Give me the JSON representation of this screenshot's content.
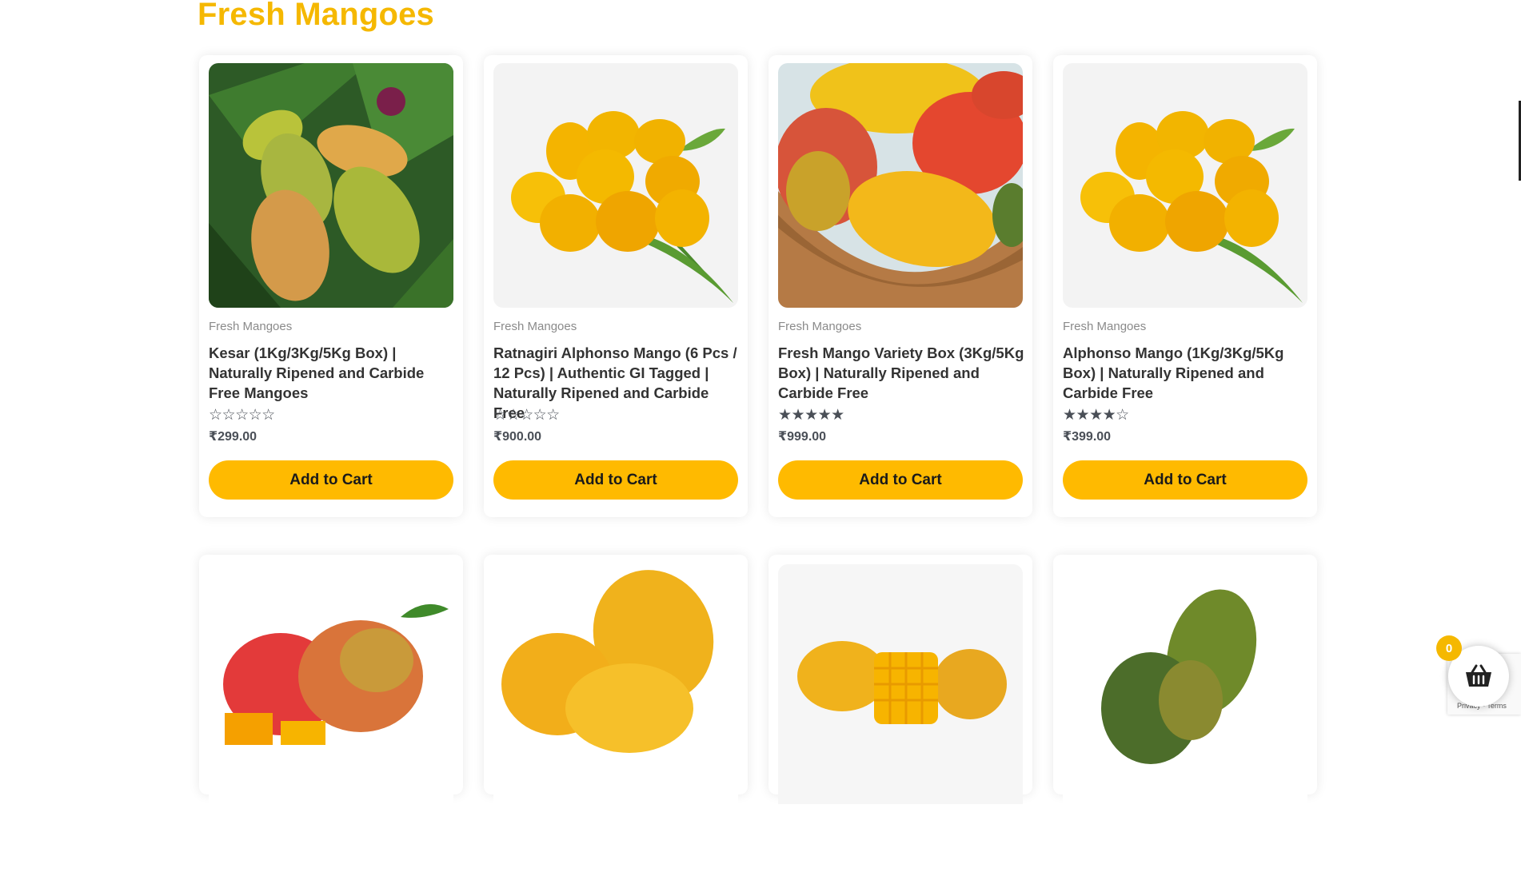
{
  "section": {
    "title": "Fresh Mangoes"
  },
  "products": [
    {
      "category": "Fresh Mangoes",
      "title": "Kesar (1Kg/3Kg/5Kg Box) | Naturally Ripened and Carbide Free Mangoes",
      "rating": 0,
      "stars": "☆☆☆☆☆",
      "price": "₹299.00",
      "button": "Add to Cart"
    },
    {
      "category": "Fresh Mangoes",
      "title": "Ratnagiri Alphonso Mango (6 Pcs / 12 Pcs) | Authentic GI Tagged | Naturally Ripened and Carbide Free",
      "rating": 0,
      "stars": "☆☆☆☆☆",
      "price": "₹900.00",
      "button": "Add to Cart"
    },
    {
      "category": "Fresh Mangoes",
      "title": "Fresh Mango Variety Box (3Kg/5Kg Box) | Naturally Ripened and Carbide Free",
      "rating": 5,
      "stars": "★★★★★",
      "price": "₹999.00",
      "button": "Add to Cart"
    },
    {
      "category": "Fresh Mangoes",
      "title": "Alphonso Mango (1Kg/3Kg/5Kg Box) | Naturally Ripened and Carbide Free",
      "rating": 4,
      "stars": "★★★★☆",
      "price": "₹399.00",
      "button": "Add to Cart"
    }
  ],
  "cart": {
    "count": "0"
  },
  "recaptcha": {
    "terms": "Privacy - Terms"
  },
  "colors": {
    "accent": "#f5b800",
    "button": "#ffba00"
  }
}
